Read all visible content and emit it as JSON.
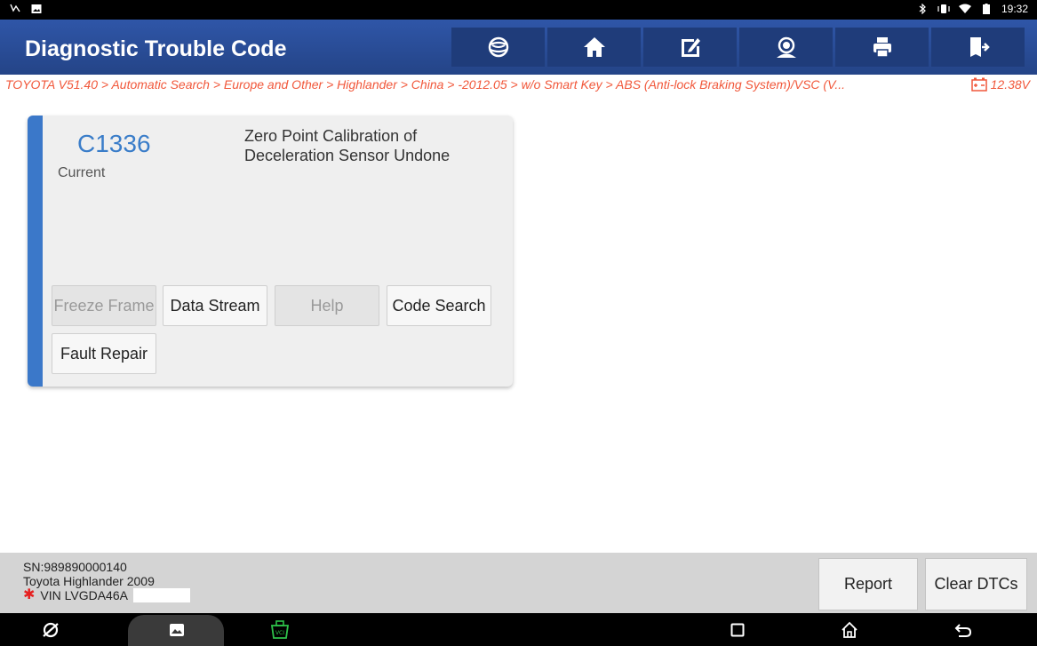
{
  "status_bar": {
    "time": "19:32"
  },
  "header": {
    "title": "Diagnostic Trouble Code",
    "toolbar_icons": [
      "globe-icon",
      "home-icon",
      "edit-icon",
      "support-icon",
      "print-icon",
      "exit-icon"
    ]
  },
  "breadcrumb": {
    "path": "TOYOTA V51.40 > Automatic Search > Europe and Other > Highlander > China > -2012.05 > w/o Smart Key > ABS (Anti-lock Braking System)/VSC (V...",
    "voltage": "12.38V"
  },
  "dtc": {
    "code": "C1336",
    "status": "Current",
    "description": "Zero Point Calibration of Deceleration Sensor Undone",
    "buttons": {
      "freeze_frame": "Freeze Frame",
      "data_stream": "Data Stream",
      "help": "Help",
      "code_search": "Code Search",
      "fault_repair": "Fault Repair"
    }
  },
  "footer": {
    "sn": "SN:989890000140",
    "vehicle": "Toyota Highlander 2009",
    "vin": "VIN LVGDA46A",
    "report_label": "Report",
    "clear_label": "Clear DTCs"
  },
  "colors": {
    "header_bg": "#2b4e9f",
    "accent_blue": "#3a7dc9",
    "breadcrumb_orange": "#f1573a"
  }
}
